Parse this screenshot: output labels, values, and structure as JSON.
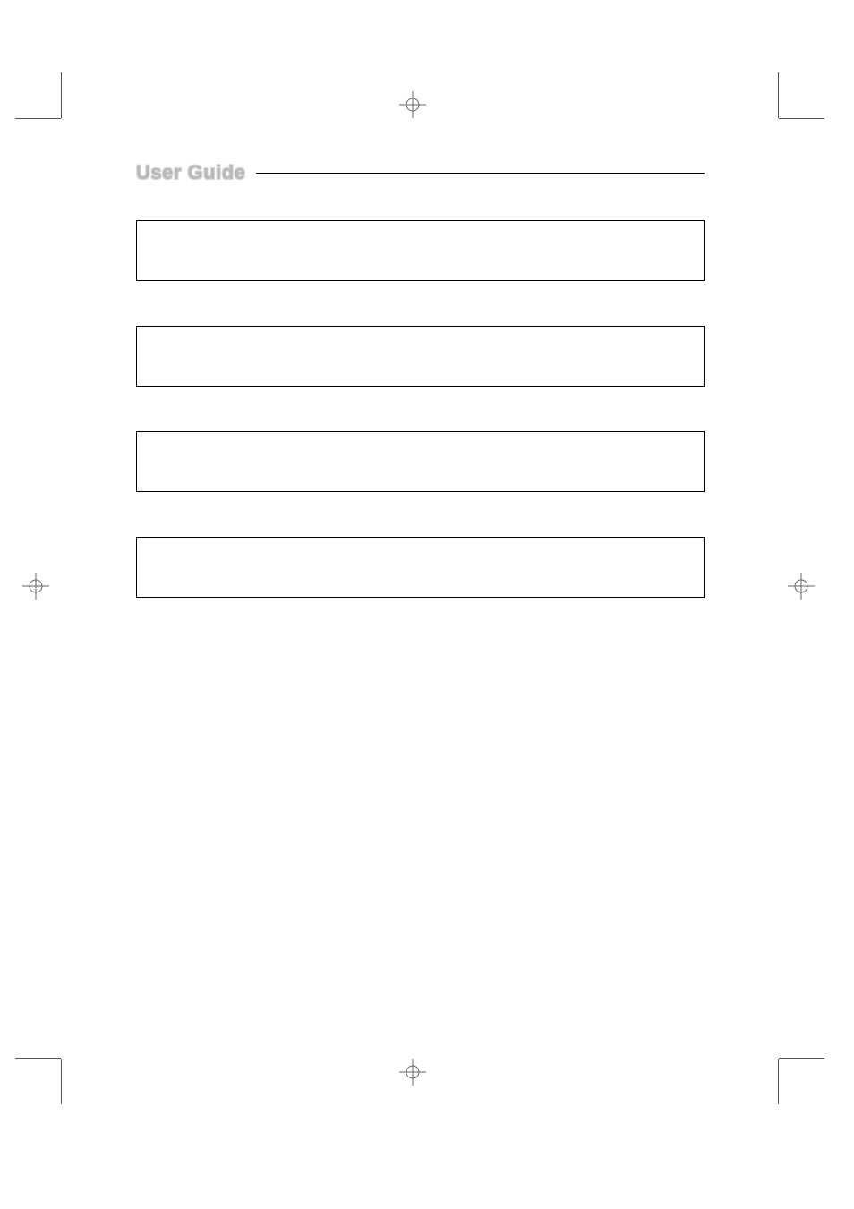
{
  "header": {
    "title": "User Guide"
  },
  "boxes": [
    {
      "type": "empty"
    },
    {
      "type": "empty"
    },
    {
      "type": "empty"
    },
    {
      "type": "empty"
    }
  ]
}
